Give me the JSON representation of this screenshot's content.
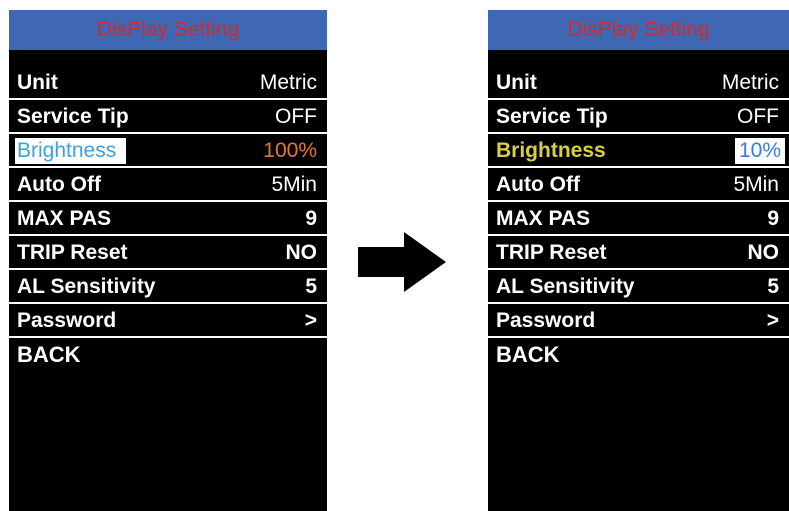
{
  "colors": {
    "title_bar": "#3e68b3",
    "title_text": "#d9262b",
    "screen_bg": "#000000",
    "highlight_orange": "#e8782a",
    "highlight_blue": "#3aa0e8",
    "highlight_yellow": "#d8d040",
    "arrow": "#000000"
  },
  "left": {
    "title": "DisPlay  Setting",
    "rows": [
      {
        "label": "Unit",
        "value": "Metric"
      },
      {
        "label": "Service Tip",
        "value": "OFF"
      },
      {
        "label": "Brightness",
        "value": "100%"
      },
      {
        "label": "Auto Off",
        "value": "5Min"
      },
      {
        "label": "MAX PAS",
        "value": "9"
      },
      {
        "label": "TRIP Reset",
        "value": "NO"
      },
      {
        "label": "AL Sensitivity",
        "value": "5"
      },
      {
        "label": "Password",
        "value": ">"
      }
    ],
    "back": "BACK"
  },
  "arrow_icon": "right-arrow-icon",
  "right": {
    "title": "DisPlay  Setting",
    "rows": [
      {
        "label": "Unit",
        "value": "Metric"
      },
      {
        "label": "Service Tip",
        "value": "OFF"
      },
      {
        "label": "Brightness",
        "value": "10%"
      },
      {
        "label": "Auto Off",
        "value": "5Min"
      },
      {
        "label": "MAX PAS",
        "value": "9"
      },
      {
        "label": "TRIP Reset",
        "value": "NO"
      },
      {
        "label": "AL Sensitivity",
        "value": "5"
      },
      {
        "label": "Password",
        "value": ">"
      }
    ],
    "back": "BACK"
  }
}
